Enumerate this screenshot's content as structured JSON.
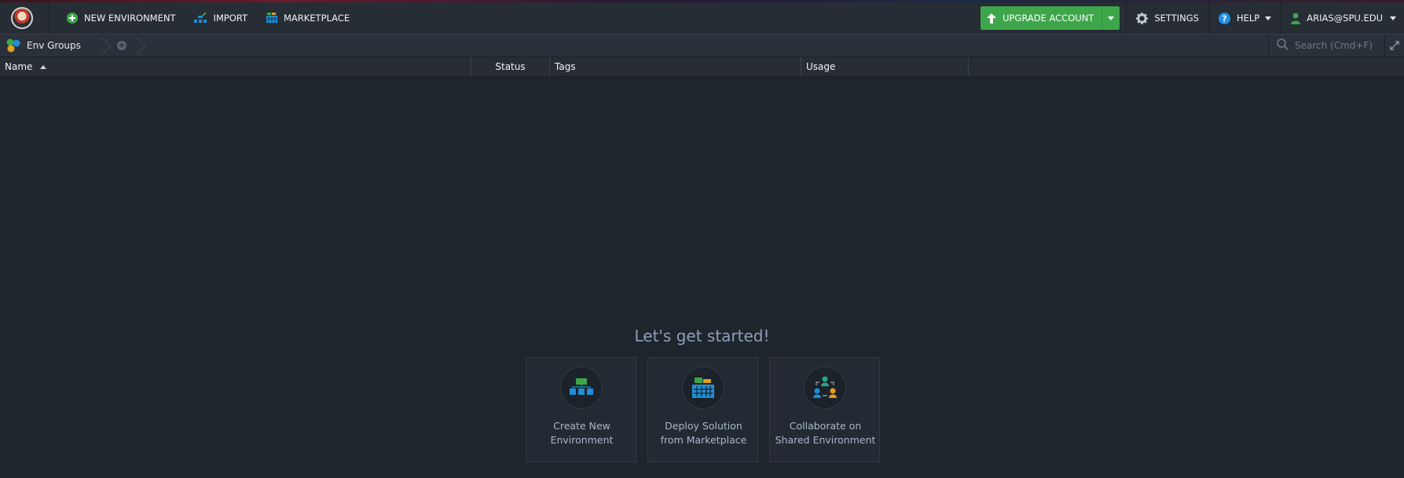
{
  "header": {
    "new_environment": "NEW ENVIRONMENT",
    "import": "IMPORT",
    "marketplace": "MARKETPLACE",
    "upgrade_account": "UPGRADE ACCOUNT",
    "settings": "SETTINGS",
    "help": "HELP",
    "user": "ARIAS@SPU.EDU"
  },
  "breadcrumb": {
    "env_groups": "Env Groups"
  },
  "search": {
    "placeholder": "Search (Cmd+F)"
  },
  "table": {
    "columns": [
      "Name",
      "Status",
      "Tags",
      "Usage"
    ]
  },
  "empty_state": {
    "title": "Let's get started!",
    "cards": [
      {
        "line1": "Create New",
        "line2": "Environment",
        "icon": "environment-icon"
      },
      {
        "line1": "Deploy Solution",
        "line2": "from Marketplace",
        "icon": "marketplace-basket-icon"
      },
      {
        "line1": "Collaborate on",
        "line2": "Shared Environment",
        "icon": "collaborate-icon"
      }
    ]
  },
  "colors": {
    "accent_green": "#3ea64a",
    "background": "#1f252d",
    "help_blue": "#1e90e8"
  }
}
